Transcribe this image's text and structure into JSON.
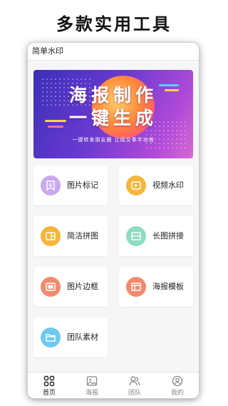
{
  "promo": {
    "title": "多款实用工具"
  },
  "app": {
    "title": "简单水印"
  },
  "banner": {
    "line1": "海报制作",
    "line2": "一键生成",
    "tagline": "一键转发朋友圈 让成交事半功倍"
  },
  "tools": [
    {
      "label": "图片标记",
      "icon": "image-tag-icon",
      "color": "#c9a8ee"
    },
    {
      "label": "视频水印",
      "icon": "video-play-icon",
      "color": "#f5b63a"
    },
    {
      "label": "简洁拼图",
      "icon": "collage-icon",
      "color": "#f5b63a"
    },
    {
      "label": "长图拼接",
      "icon": "long-image-icon",
      "color": "#8fdcc0"
    },
    {
      "label": "图片边框",
      "icon": "frame-icon",
      "color": "#f28a6e"
    },
    {
      "label": "海报模板",
      "icon": "poster-template-icon",
      "color": "#f28a6e"
    },
    {
      "label": "团队素材",
      "icon": "folder-icon",
      "color": "#6ec9f0"
    }
  ],
  "tabs": [
    {
      "label": "首页",
      "icon": "home-grid-icon",
      "active": true
    },
    {
      "label": "海报",
      "icon": "poster-icon",
      "active": false
    },
    {
      "label": "团队",
      "icon": "team-icon",
      "active": false
    },
    {
      "label": "我的",
      "icon": "profile-icon",
      "active": false
    }
  ]
}
